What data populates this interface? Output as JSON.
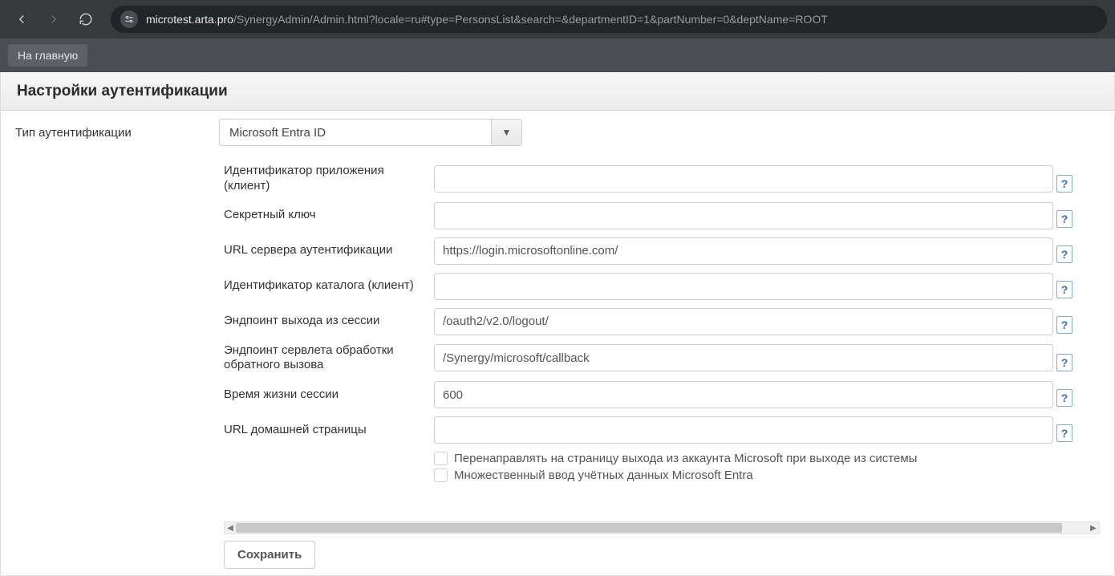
{
  "browser": {
    "url_host": "microtest.arta.pro",
    "url_path": "/SynergyAdmin/Admin.html?locale=ru#type=PersonsList&search=&departmentID=1&partNumber=0&deptName=ROOT"
  },
  "topbar": {
    "home_label": "На главную"
  },
  "page": {
    "title": "Настройки аутентификации"
  },
  "auth_type": {
    "label": "Тип аутентификации",
    "selected": "Microsoft Entra ID"
  },
  "fields": {
    "app_id": {
      "label": "Идентификатор приложения (клиент)",
      "value": ""
    },
    "secret_key": {
      "label": "Секретный ключ",
      "value": ""
    },
    "auth_server_url": {
      "label": "URL сервера аутентификации",
      "value": "https://login.microsoftonline.com/"
    },
    "catalog_id": {
      "label": "Идентификатор каталога (клиент)",
      "value": ""
    },
    "logout_endpoint": {
      "label": "Эндпоинт выхода из сессии",
      "value": "/oauth2/v2.0/logout/"
    },
    "callback_endpoint": {
      "label": "Эндпоинт сервлета обработки обратного вызова",
      "value": "/Synergy/microsoft/callback"
    },
    "session_ttl": {
      "label": "Время жизни сессии",
      "value": "600"
    },
    "home_url": {
      "label": "URL домашней страницы",
      "value": ""
    }
  },
  "checkboxes": {
    "redirect_on_logout": "Перенаправлять на страницу выхода из аккаунта Microsoft при выходе из системы",
    "multi_entry": "Множественный ввод учётных данных Microsoft Entra"
  },
  "actions": {
    "save": "Сохранить",
    "help_glyph": "?"
  }
}
